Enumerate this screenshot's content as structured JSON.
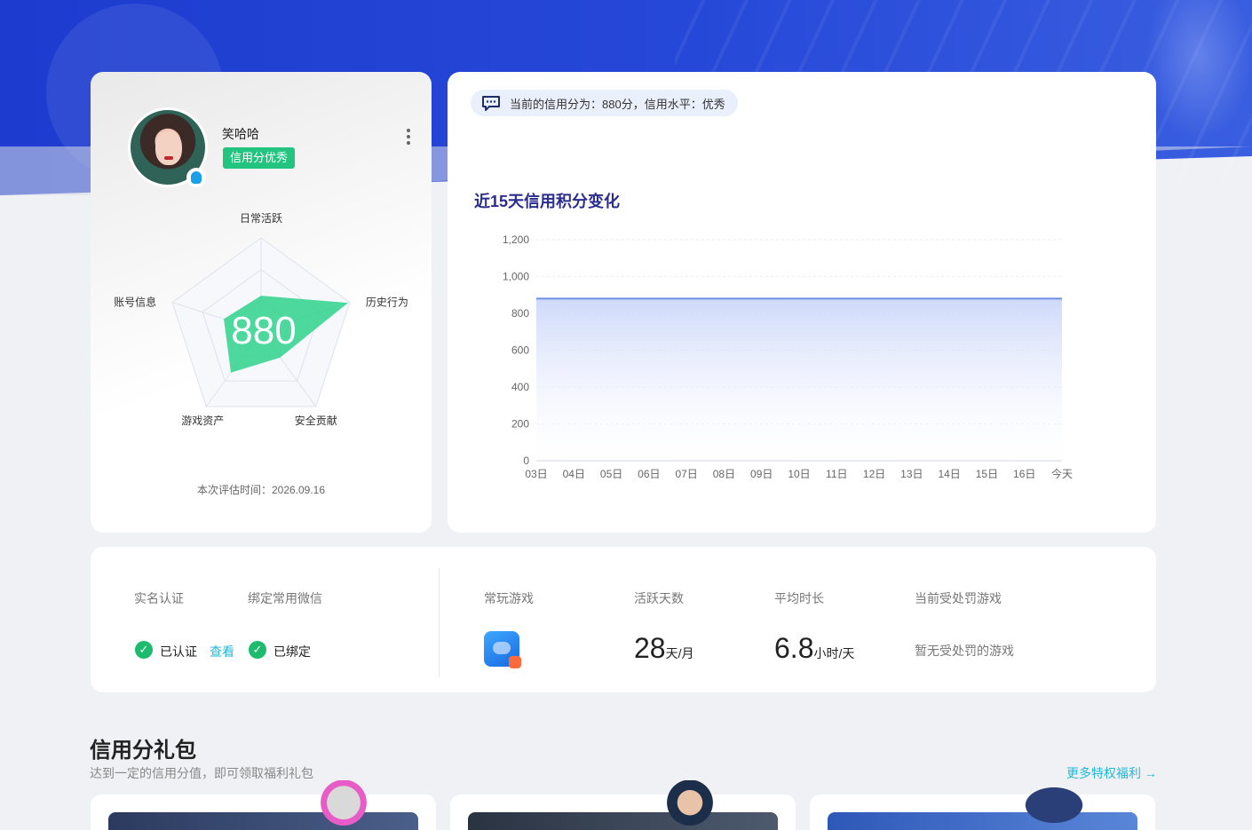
{
  "profile": {
    "username": "笑哈哈",
    "credit_tag": "信用分优秀",
    "radar": {
      "center_score": "880",
      "axes": [
        "日常活跃",
        "历史行为",
        "安全贡献",
        "游戏资产",
        "账号信息"
      ]
    },
    "eval_time": "本次评估时间：2026.09.16"
  },
  "score_banner": "当前的信用分为：880分，信用水平：优秀",
  "chart_data": {
    "type": "area",
    "title": "近15天信用积分变化",
    "categories": [
      "03日",
      "04日",
      "05日",
      "06日",
      "07日",
      "08日",
      "09日",
      "10日",
      "11日",
      "12日",
      "13日",
      "14日",
      "15日",
      "16日",
      "今天"
    ],
    "series": [
      {
        "values": [
          880,
          880,
          880,
          880,
          880,
          880,
          880,
          880,
          880,
          880,
          880,
          880,
          880,
          880,
          880
        ]
      }
    ],
    "yticks": [
      "0",
      "200",
      "400",
      "600",
      "800",
      "1,000",
      "1,200"
    ],
    "ylim": [
      0,
      1200
    ],
    "grid": true
  },
  "stats": {
    "real_name_label": "实名认证",
    "real_name_value": "已认证",
    "view_link": "查看",
    "wechat_label": "绑定常用微信",
    "wechat_value": "已绑定",
    "games_label": "常玩游戏",
    "active_days_label": "活跃天数",
    "active_days_value": "28",
    "active_days_unit": "天/月",
    "avg_time_label": "平均时长",
    "avg_time_value": "6.8",
    "avg_time_unit": "小时/天",
    "penalty_label": "当前受处罚游戏",
    "penalty_value": "暂无受处罚的游戏"
  },
  "gifts": {
    "title": "信用分礼包",
    "subtitle": "达到一定的信用分值，即可领取福利礼包",
    "more_link": "更多特权福利 →"
  },
  "colors": {
    "accent": "#22c47f",
    "brand_blue": "#2648d8",
    "link": "#22b8d8",
    "line": "#6f8ee8"
  },
  "icons": [
    "more-icon",
    "qq-icon",
    "chat-icon",
    "check-icon",
    "game-icon"
  ]
}
